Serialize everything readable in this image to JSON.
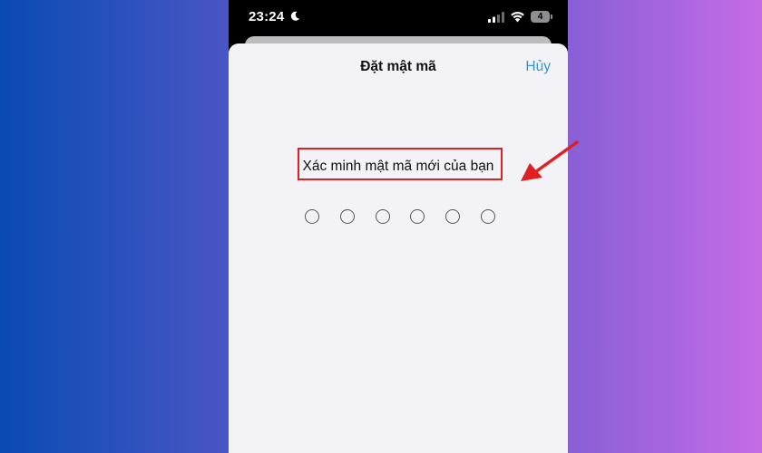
{
  "status_bar": {
    "time": "23:24",
    "battery": "4",
    "icons": [
      "moon-icon",
      "signal-icon",
      "wifi-icon",
      "battery-icon"
    ]
  },
  "sheet": {
    "title": "Đặt mật mã",
    "cancel_label": "Hủy",
    "prompt": "Xác minh mật mã mới của bạn",
    "passcode_length": 6,
    "digits_entered": 0
  },
  "colors": {
    "accent": "#3a93c9",
    "highlight": "#e02020",
    "sheet_background": "#f2f2f7"
  }
}
